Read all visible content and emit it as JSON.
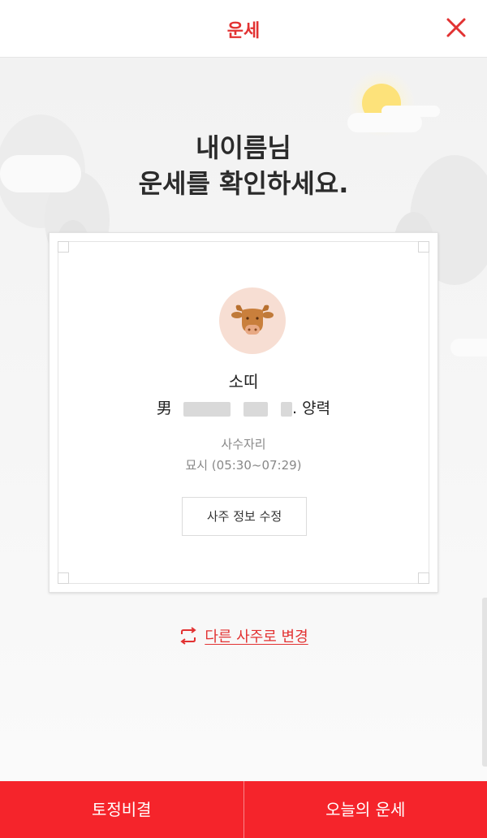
{
  "header": {
    "title": "운세",
    "close_icon": "close-icon"
  },
  "headline": {
    "line1": "내이름님",
    "line2": "운세를 확인하세요."
  },
  "profile": {
    "zodiac_icon": "ox-icon",
    "zodiac_name": "소띠",
    "gender": "男",
    "calendar_type": ". 양력",
    "star_sign": "사수자리",
    "birth_time": "묘시  (05:30~07:29)",
    "edit_button": "사주 정보 수정"
  },
  "change_link": {
    "label": "다른 사주로 변경",
    "icon": "swap-icon"
  },
  "bottom_nav": {
    "left": "토정비결",
    "right": "오늘의 운세"
  },
  "colors": {
    "accent": "#e23232",
    "bottom_bar": "#f5242b",
    "zodiac_bg": "#f7ded3"
  }
}
